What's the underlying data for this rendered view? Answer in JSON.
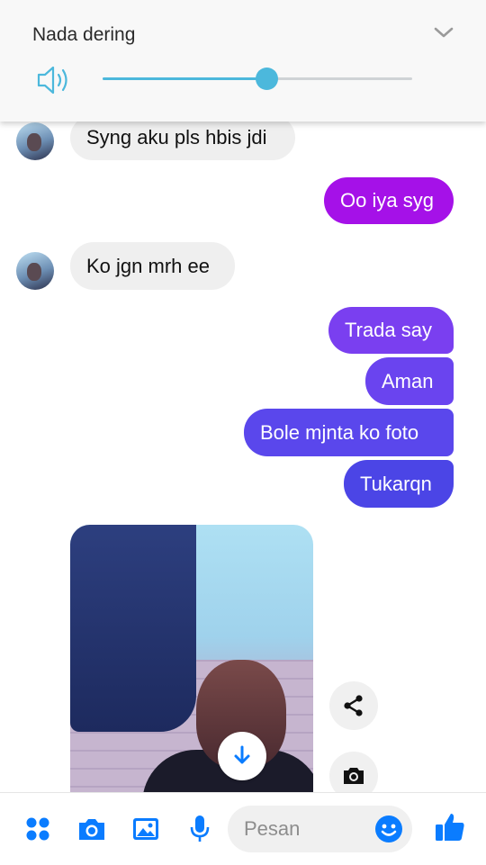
{
  "volume_panel": {
    "title": "Nada dering",
    "level": 0.53,
    "accent": "#4cb8dc"
  },
  "messages": {
    "in_1": "Syng aku pls hbis jdi",
    "out_1": "Oo iya syg",
    "in_2": "Ko jgn mrh ee",
    "out_2": "Trada say",
    "out_3": "Aman",
    "out_4": "Bole mjnta ko foto",
    "out_5": "Tukarqn"
  },
  "composer": {
    "placeholder": "Pesan",
    "icons": [
      "apps-icon",
      "camera-icon",
      "gallery-icon",
      "microphone-icon",
      "emoji-icon",
      "like-icon"
    ]
  },
  "colors": {
    "accent_blue": "#0a7cff",
    "bubble_purple_top": "#a511e8",
    "bubble_purple_mid": "#7b3cf0",
    "bubble_blue_bottom": "#4b45e6",
    "incoming_bubble": "#efefef"
  }
}
